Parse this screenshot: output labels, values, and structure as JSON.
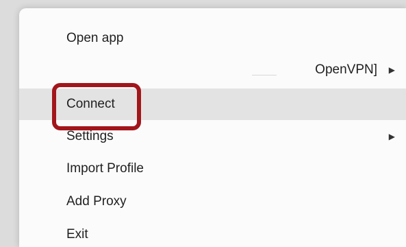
{
  "menu": {
    "items": [
      {
        "label": "Open app",
        "submenu": false
      },
      {
        "label": "OpenVPN]",
        "submenu": true
      },
      {
        "label": "Connect",
        "submenu": false,
        "highlighted": true
      },
      {
        "label": "Settings",
        "submenu": true
      },
      {
        "label": "Import Profile",
        "submenu": false
      },
      {
        "label": "Add Proxy",
        "submenu": false
      },
      {
        "label": "Exit",
        "submenu": false
      }
    ],
    "submenu_arrow_icon": "triangle-right-icon",
    "highlight_color": "#e3e3e3",
    "annotation_color": "#a2161b"
  }
}
